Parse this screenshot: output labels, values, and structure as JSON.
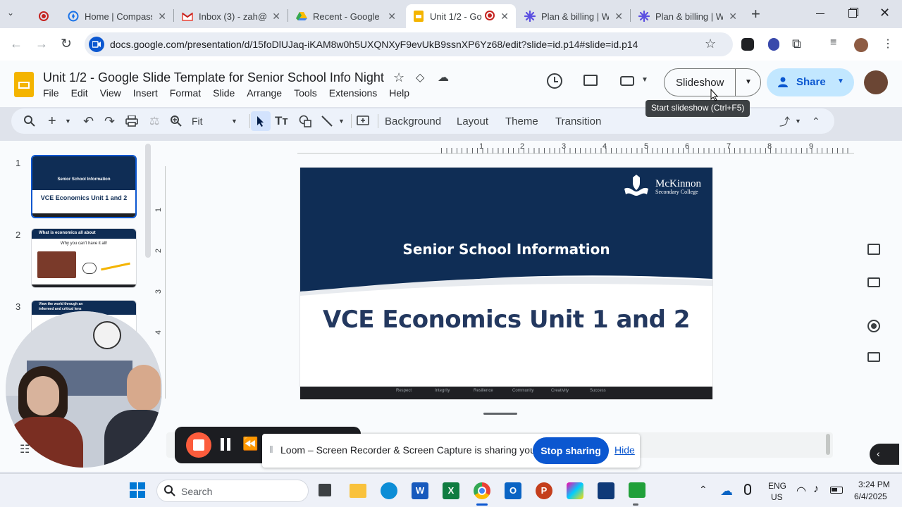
{
  "browser": {
    "tabs": [
      {
        "title": "",
        "icon": "recording-icon"
      },
      {
        "title": "Home | Compass",
        "icon": "compass-icon"
      },
      {
        "title": "Inbox (3) - zah@",
        "icon": "gmail-icon"
      },
      {
        "title": "Recent - Google",
        "icon": "drive-icon"
      },
      {
        "title": "Unit 1/2 - Go",
        "icon": "slides-icon",
        "active": true
      },
      {
        "title": "Plan & billing | W",
        "icon": "plan-icon"
      },
      {
        "title": "Plan & billing | W",
        "icon": "plan-icon"
      }
    ],
    "new_tab": "+",
    "url": "docs.google.com/presentation/d/15foDlUJaq-iKAM8w0h5UXQNXyF9evUkB9ssnXP6Yz68/edit?slide=id.p14#slide=id.p14"
  },
  "doc": {
    "title": "Unit 1/2 - Google Slide Template for Senior School Info Night",
    "menus": [
      "File",
      "Edit",
      "View",
      "Insert",
      "Format",
      "Slide",
      "Arrange",
      "Tools",
      "Extensions",
      "Help"
    ],
    "slideshow_label": "Slideshow",
    "share_label": "Share",
    "tooltip": "Start slideshow (Ctrl+F5)"
  },
  "toolbar": {
    "zoom": "Fit",
    "background": "Background",
    "layout": "Layout",
    "theme": "Theme",
    "transition": "Transition"
  },
  "ruler": {
    "h_ticks": [
      "1",
      "2",
      "3",
      "4",
      "5",
      "6",
      "7",
      "8",
      "9"
    ],
    "v_ticks": [
      "1",
      "2",
      "3",
      "4"
    ]
  },
  "filmstrip": {
    "items": [
      {
        "num": "1",
        "heading": "Senior School Information",
        "title": "VCE Economics Unit 1 and 2"
      },
      {
        "num": "2",
        "heading": "What is economics all about",
        "subtitle": "Why you can't have it all!"
      },
      {
        "num": "3",
        "heading": "View the world through an informed and critical lens"
      }
    ]
  },
  "slide": {
    "logo_name": "McKinnon",
    "logo_sub": "Secondary College",
    "heading": "Senior School Information",
    "title": "VCE Economics Unit 1 and 2",
    "footer": [
      "Respect",
      "Integrity",
      "Resilience",
      "Community",
      "Creativity",
      "Success"
    ]
  },
  "loom": {
    "message": "Loom – Screen Recorder & Screen Capture is sharing your screen.",
    "stop_label": "Stop sharing",
    "hide_label": "Hide"
  },
  "taskbar": {
    "search": "Search",
    "lang1": "ENG",
    "lang2": "US",
    "time": "3:24 PM",
    "date": "6/4/2025"
  },
  "colors": {
    "slide_navy": "#0f2d55",
    "accent_blue": "#0b57d0",
    "slides_yellow": "#f4b400",
    "loom_red": "#fc5c3c"
  }
}
